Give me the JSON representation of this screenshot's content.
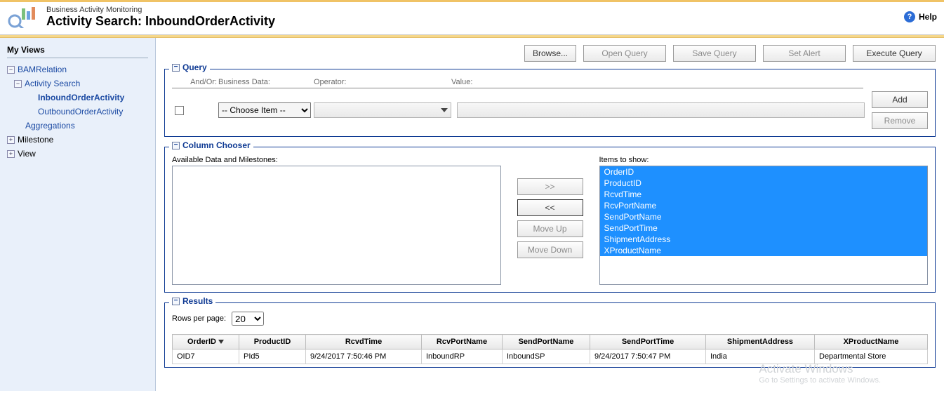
{
  "header": {
    "subtitle": "Business Activity Monitoring",
    "title": "Activity Search: InboundOrderActivity",
    "help_label": "Help"
  },
  "sidebar": {
    "heading": "My Views",
    "nodes": {
      "bam_relation": "BAMRelation",
      "activity_search": "Activity Search",
      "inbound": "InboundOrderActivity",
      "outbound": "OutboundOrderActivity",
      "aggregations": "Aggregations",
      "milestone": "Milestone",
      "view": "View"
    }
  },
  "toolbar": {
    "browse": "Browse...",
    "open_query": "Open Query",
    "save_query": "Save Query",
    "set_alert": "Set Alert",
    "execute_query": "Execute Query"
  },
  "query": {
    "legend": "Query",
    "labels": {
      "andor": "And/Or:",
      "biz": "Business Data:",
      "op": "Operator:",
      "val": "Value:"
    },
    "choose_item": "-- Choose Item --",
    "add": "Add",
    "remove": "Remove"
  },
  "chooser": {
    "legend": "Column Chooser",
    "available_label": "Available Data and Milestones:",
    "items_label": "Items to show:",
    "move_right": ">>",
    "move_left": "<<",
    "move_up": "Move Up",
    "move_down": "Move Down",
    "items": [
      "OrderID",
      "ProductID",
      "RcvdTime",
      "RcvPortName",
      "SendPortName",
      "SendPortTime",
      "ShipmentAddress",
      "XProductName"
    ]
  },
  "results": {
    "legend": "Results",
    "rows_per_page_label": "Rows per page:",
    "rows_per_page_value": "20",
    "columns": [
      "OrderID",
      "ProductID",
      "RcvdTime",
      "RcvPortName",
      "SendPortName",
      "SendPortTime",
      "ShipmentAddress",
      "XProductName"
    ],
    "rows": [
      {
        "OrderID": "OID7",
        "ProductID": "PId5",
        "RcvdTime": "9/24/2017 7:50:46 PM",
        "RcvPortName": "InboundRP",
        "SendPortName": "InboundSP",
        "SendPortTime": "9/24/2017 7:50:47 PM",
        "ShipmentAddress": "India",
        "XProductName": "Departmental Store"
      }
    ]
  },
  "watermark": {
    "l1": "Activate Windows",
    "l2": "Go to Settings to activate Windows."
  }
}
